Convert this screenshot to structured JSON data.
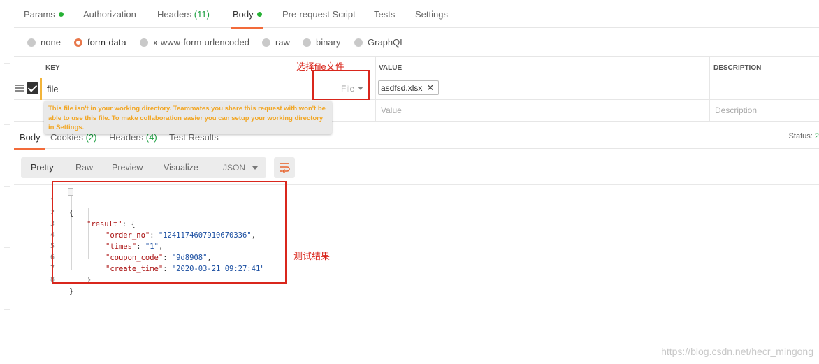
{
  "request_tabs": [
    {
      "label": "Params",
      "dot": true
    },
    {
      "label": "Authorization"
    },
    {
      "label": "Headers",
      "count": "(11)"
    },
    {
      "label": "Body",
      "dot": true,
      "active": true
    },
    {
      "label": "Pre-request Script"
    },
    {
      "label": "Tests"
    },
    {
      "label": "Settings"
    }
  ],
  "body_types": [
    {
      "label": "none"
    },
    {
      "label": "form-data",
      "checked": true
    },
    {
      "label": "x-www-form-urlencoded"
    },
    {
      "label": "raw"
    },
    {
      "label": "binary"
    },
    {
      "label": "GraphQL"
    }
  ],
  "kv_table": {
    "headers": {
      "key": "KEY",
      "value": "VALUE",
      "description": "DESCRIPTION"
    },
    "row": {
      "key": "file",
      "type": "File",
      "file_name": "asdfsd.xlsx",
      "remove_icon": "✕"
    },
    "placeholders": {
      "value": "Value",
      "description": "Description"
    }
  },
  "tooltip": "This file isn't in your working directory. Teammates you share this request with won't be able to use this file. To make collaboration easier you can setup your working directory in Settings.",
  "response_tabs": [
    {
      "label": "Body",
      "active": true
    },
    {
      "label": "Cookies",
      "count": "(2)"
    },
    {
      "label": "Headers",
      "count": "(4)"
    },
    {
      "label": "Test Results"
    }
  ],
  "status": {
    "label": "Status:",
    "value": "2"
  },
  "view_modes": [
    "Pretty",
    "Raw",
    "Preview",
    "Visualize"
  ],
  "format": "JSON",
  "code": {
    "line_numbers": [
      "1",
      "2",
      "3",
      "4",
      "5",
      "6",
      "7",
      "8"
    ],
    "open_brace": "{",
    "result_key": "\"result\"",
    "result_open": ": {",
    "fields": [
      {
        "key": "\"order_no\"",
        "value": "\"1241174607910670336\"",
        "comma": ","
      },
      {
        "key": "\"times\"",
        "value": "\"1\"",
        "comma": ","
      },
      {
        "key": "\"coupon_code\"",
        "value": "\"9d8908\"",
        "comma": ","
      },
      {
        "key": "\"create_time\"",
        "value": "\"2020-03-21 09:27:41\"",
        "comma": ""
      }
    ],
    "inner_close": "}",
    "outer_close": "}"
  },
  "annotations": {
    "select_file": "选择file文件",
    "test_result": "测试结果"
  },
  "watermark": "https://blog.csdn.net/hecr_mingong",
  "colors": {
    "accent": "#f26b3a",
    "annotation": "#d9261c",
    "warning": "#f2a623",
    "count_green": "#1a9f3f"
  }
}
